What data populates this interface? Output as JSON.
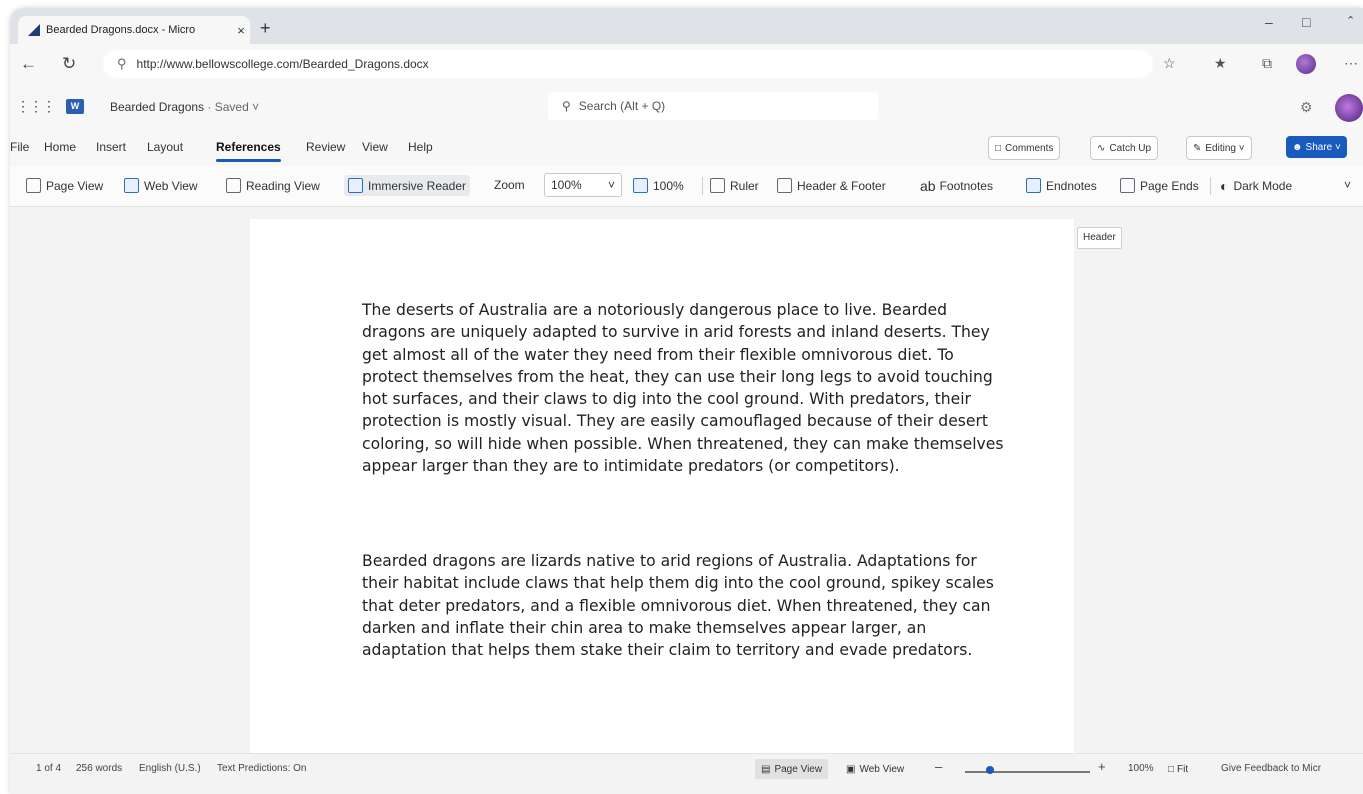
{
  "browser": {
    "tab_title": "Bearded Dragons.docx - Micro",
    "tab_close": "×",
    "new_tab": "+",
    "url": "http://www.bellowscollege.com/Bearded_Dragons.docx"
  },
  "word": {
    "doc_name": "Bearded Dragons",
    "saved_state": "· Saved ˅",
    "search_placeholder": "Search (Alt + Q)",
    "app_letter": "W"
  },
  "menu": {
    "items": [
      "File",
      "Home",
      "Insert",
      "Layout",
      "References",
      "Review",
      "View",
      "Help"
    ],
    "active": "References",
    "comments": "Comments",
    "catch_up": "Catch Up",
    "editing": "Editing ˅",
    "share": "Share ˅"
  },
  "toolbar": {
    "page_view": "Page View",
    "web_view": "Web View",
    "reading_view": "Reading View",
    "immersive_reader": "Immersive Reader",
    "zoom_label": "Zoom",
    "zoom_value": "100%",
    "zoom_100": "100%",
    "ruler": "Ruler",
    "header_footer": "Header & Footer",
    "footnotes": "Footnotes",
    "endnotes": "Endnotes",
    "page_ends": "Page Ends",
    "dark_mode": "Dark Mode"
  },
  "document": {
    "header_label": "Header",
    "paragraphs": [
      "The deserts of Australia are a notoriously dangerous place to live. Bearded dragons are uniquely adapted to survive in arid forests and inland deserts. They get almost all of the water they need from their flexible omnivorous diet. To protect themselves from the heat, they can use their long legs to avoid touching hot surfaces, and their claws to dig into the cool ground. With predators, their protection is mostly visual. They are easily camouflaged because of their desert coloring, so will hide when possible. When threatened, they can make themselves appear larger than they are to intimidate predators (or competitors).",
      "Bearded dragons are lizards native to arid regions of Australia. Adaptations for their habitat include claws that help them dig into the cool ground, spikey scales that deter predators, and a flexible omnivorous diet. When threatened, they can darken and inflate their chin area to make themselves appear larger, an adaptation that helps them stake their claim to territory and evade predators."
    ]
  },
  "status": {
    "page": "1 of 4",
    "words": "256 words",
    "language": "English (U.S.)",
    "predictions": "Text Predictions: On",
    "page_view": "Page View",
    "web_view": "Web View",
    "zoom": "100%",
    "fit": "Fit",
    "feedback": "Give Feedback to Micr"
  },
  "colors": {
    "accent": "#185abd",
    "share_button": "#185abd"
  }
}
